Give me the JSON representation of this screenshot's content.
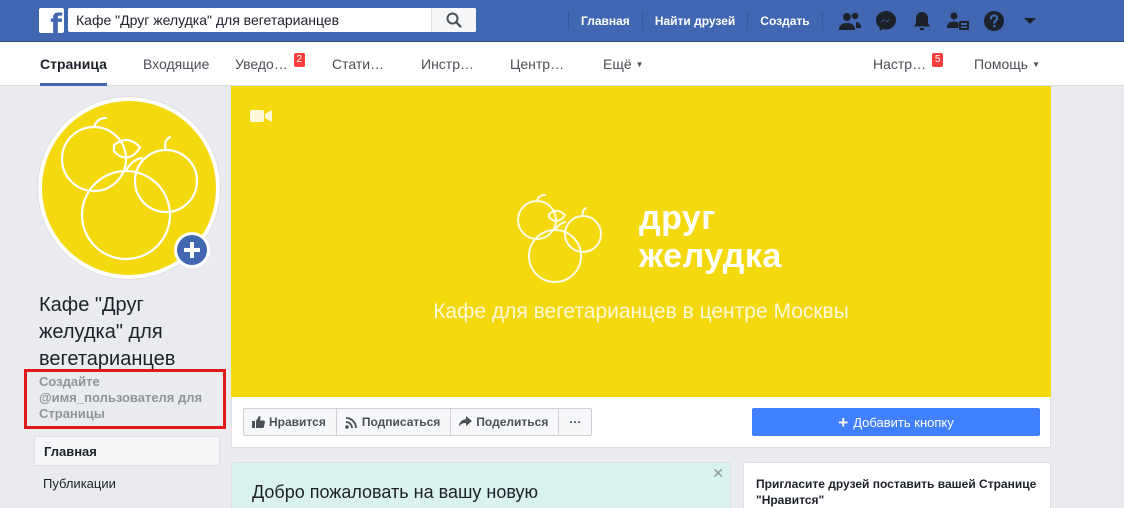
{
  "topbar": {
    "search": {
      "value": "Кафе \"Друг желудка\" для вегетарианцев"
    },
    "nav": {
      "home": "Главная",
      "find_friends": "Найти друзей",
      "create": "Создать"
    }
  },
  "pagetabs": {
    "page": "Страница",
    "inbox": "Входящие",
    "notifications": "Уведо…",
    "notifications_badge": "2",
    "stats": "Стати…",
    "tools": "Инстр…",
    "center": "Центр…",
    "more": "Ещё",
    "settings": "Настр…",
    "settings_badge": "5",
    "help": "Помощь"
  },
  "profile": {
    "name": "Кафе \"Друг желудка\" для вегетарианцев",
    "create_username": "Создайте @имя_пользователя для Страницы"
  },
  "leftnav": {
    "items": [
      "Главная",
      "Публикации"
    ]
  },
  "cover": {
    "brand_line1": "друг",
    "brand_line2": "желудка",
    "tagline": "Кафе для вегетарианцев в центре Москвы"
  },
  "actions": {
    "like": "Нравится",
    "follow": "Подписаться",
    "share": "Поделиться",
    "more": "···",
    "add_button": "Добавить кнопку"
  },
  "cards": {
    "welcome": "Добро пожаловать на вашу новую",
    "close": "✕",
    "invite": "Пригласите друзей поставить вашей Странице \"Нравится\""
  },
  "colors": {
    "brand_blue": "#4267b2",
    "cover_yellow": "#f5d90f",
    "cta_blue": "#4080ff",
    "highlight_red": "#e0191b"
  }
}
